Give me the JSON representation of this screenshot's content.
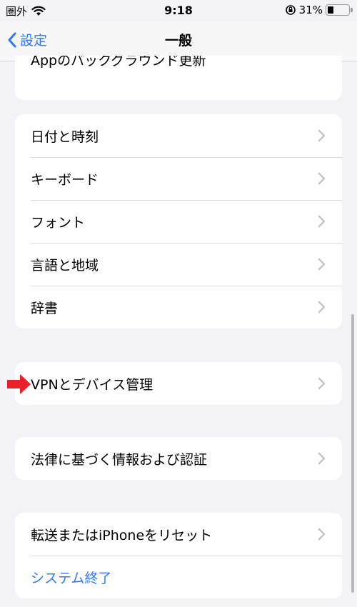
{
  "status": {
    "carrier": "圏外",
    "time": "9:18",
    "battery_percent": "31%",
    "battery_level": 0.31
  },
  "nav": {
    "back_label": "設定",
    "title": "一般"
  },
  "clipped_row": {
    "label": "Appのバックグラウンド更新"
  },
  "group1": [
    {
      "label": "日付と時刻"
    },
    {
      "label": "キーボード"
    },
    {
      "label": "フォント"
    },
    {
      "label": "言語と地域"
    },
    {
      "label": "辞書"
    }
  ],
  "group2": [
    {
      "label": "VPNとデバイス管理"
    }
  ],
  "group3": [
    {
      "label": "法律に基づく情報および認証"
    }
  ],
  "group4": [
    {
      "label": "転送またはiPhoneをリセット"
    },
    {
      "label": "システム終了"
    }
  ],
  "colors": {
    "accent": "#2f7bf5",
    "background": "#f2f2f7",
    "annotation_arrow": "#e8202a"
  }
}
